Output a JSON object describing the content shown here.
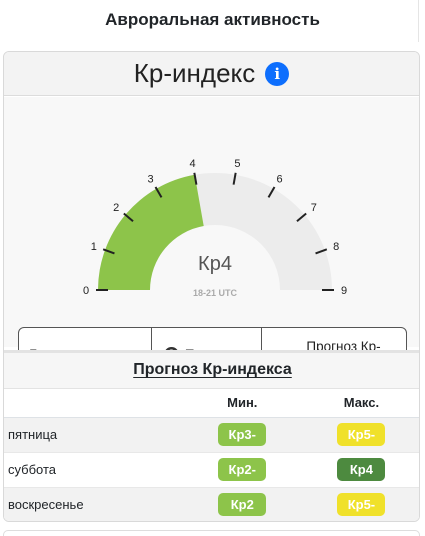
{
  "page_title": "Авроральная активность",
  "card": {
    "title": "Кр-индекс",
    "info_icon": "info-icon"
  },
  "gauge": {
    "value": 4,
    "value_label": "Кр4",
    "time_label": "18-21 UTC",
    "min": 0,
    "max": 9,
    "ticks": [
      "0",
      "1",
      "2",
      "3",
      "4",
      "5",
      "6",
      "7",
      "8",
      "9"
    ],
    "fill_color": "#8dc44a",
    "track_color": "#ececec"
  },
  "buttons": {
    "more": "Больше данных",
    "help": "Помощь",
    "forecast": "Прогноз Кр-индекса"
  },
  "forecast": {
    "title": "Прогноз Кр-индекса",
    "col_min": "Мин.",
    "col_max": "Макс.",
    "rows": [
      {
        "day": "пятница",
        "min": "Кр3-",
        "max": "Кр5-",
        "min_color": "#8dc44a",
        "max_color": "#f0e12a"
      },
      {
        "day": "суббота",
        "min": "Кр2-",
        "max": "Кр4",
        "min_color": "#8dc44a",
        "max_color": "#4d8a3f"
      },
      {
        "day": "воскресенье",
        "min": "Кр2",
        "max": "Кр5-",
        "min_color": "#8dc44a",
        "max_color": "#f0e12a"
      }
    ]
  }
}
